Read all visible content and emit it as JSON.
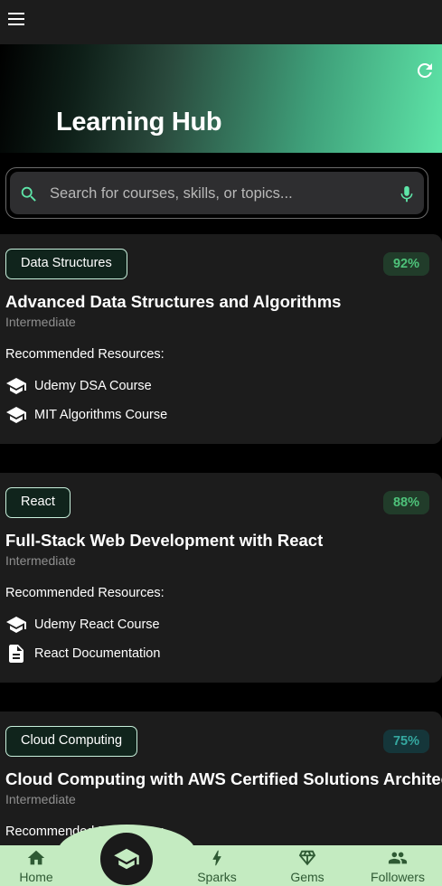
{
  "header": {
    "menu_icon": "menu-icon",
    "refresh_icon": "refresh-icon"
  },
  "hero": {
    "title": "Learning Hub"
  },
  "search": {
    "placeholder": "Search for courses, skills, or topics...",
    "value": "",
    "search_icon": "search-icon",
    "mic_icon": "mic-icon"
  },
  "colors": {
    "accent": "#5ee5a8",
    "card_bg": "#1c1c1c",
    "nav_bg": "#c4ebc1",
    "match_green": "#4ec27a",
    "match_teal": "#35a8a0"
  },
  "recommended_label": "Recommended Resources:",
  "courses": [
    {
      "tag": "Data Structures",
      "match": "92%",
      "title": "Advanced Data Structures and Algorithms",
      "level": "Intermediate",
      "resources": [
        {
          "icon": "school-icon",
          "label": "Udemy DSA Course"
        },
        {
          "icon": "school-icon",
          "label": "MIT Algorithms Course"
        }
      ]
    },
    {
      "tag": "React",
      "match": "88%",
      "title": "Full-Stack Web Development with React",
      "level": "Intermediate",
      "resources": [
        {
          "icon": "school-icon",
          "label": "Udemy React Course"
        },
        {
          "icon": "document-icon",
          "label": "React Documentation"
        }
      ]
    },
    {
      "tag": "Cloud Computing",
      "match": "75%",
      "title": "Cloud Computing with AWS Certified Solutions Architect",
      "level": "Intermediate",
      "resources": []
    }
  ],
  "bottom_nav": {
    "fab_icon": "school-icon",
    "items": [
      {
        "icon": "home-icon",
        "label": "Home"
      },
      {
        "icon": "bolt-icon",
        "label": "Sparks"
      },
      {
        "icon": "gem-icon",
        "label": "Gems"
      },
      {
        "icon": "people-icon",
        "label": "Followers"
      }
    ]
  }
}
